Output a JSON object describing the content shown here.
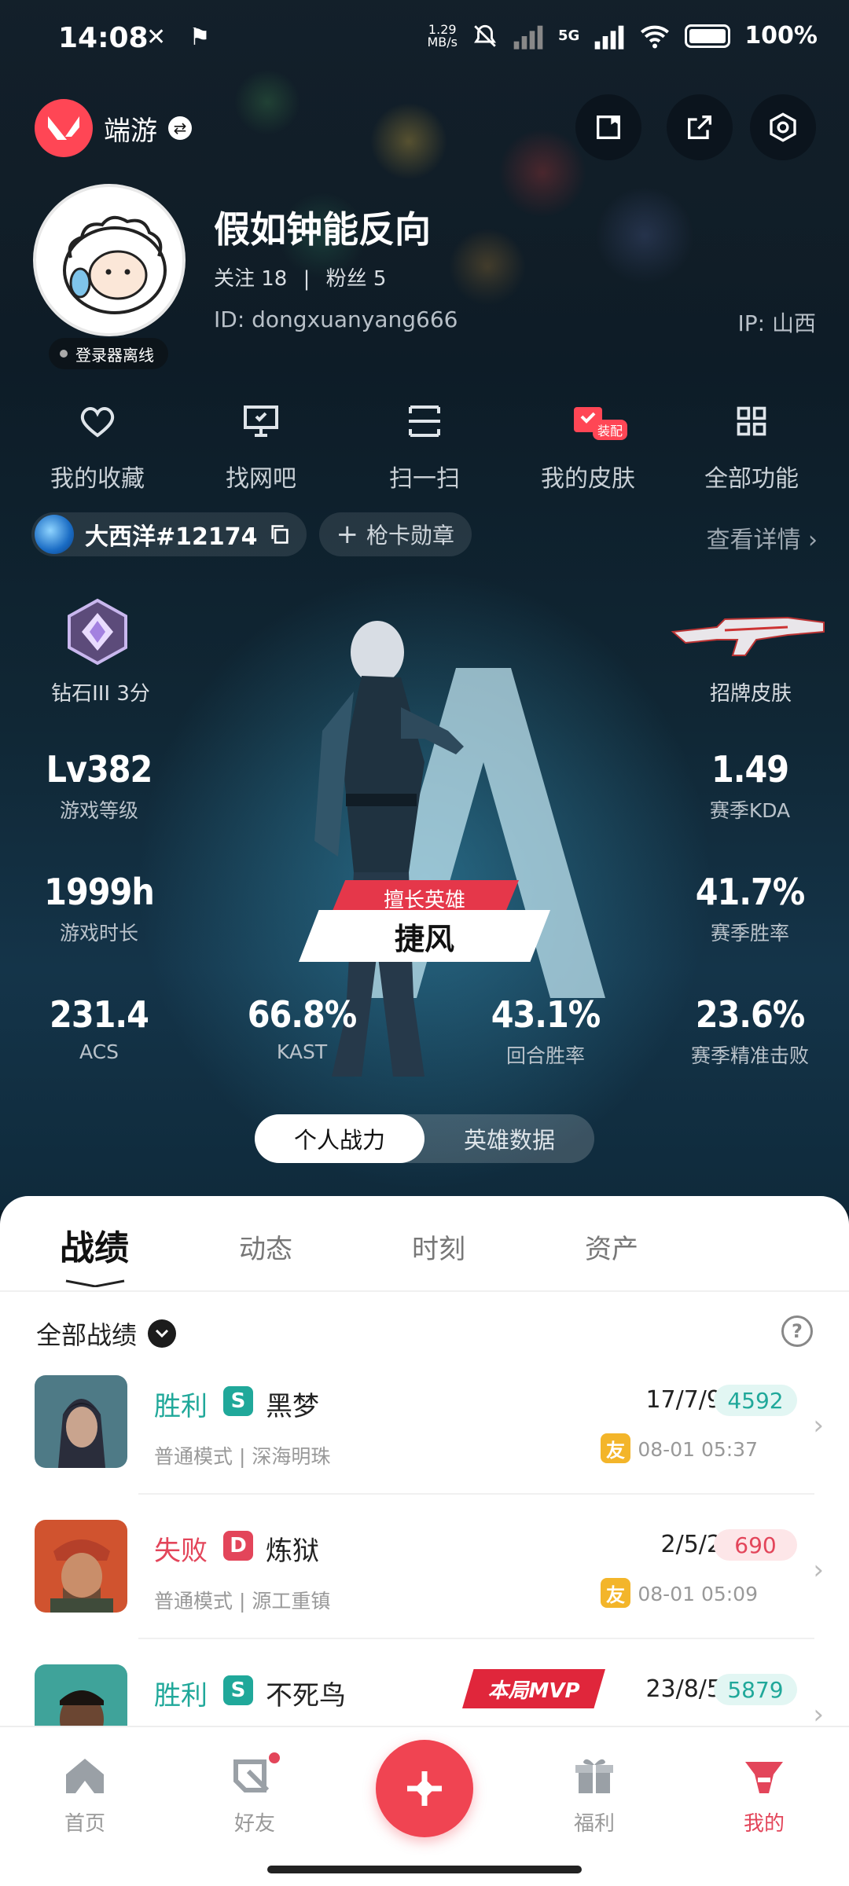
{
  "status_bar": {
    "time": "14:08",
    "left_icons": "✕ ⚑",
    "net_speed_value": "1.29",
    "net_speed_unit": "MB/s",
    "signal": "5G",
    "battery": "100%"
  },
  "header": {
    "app_name": "端游"
  },
  "profile": {
    "nickname": "假如钟能反向",
    "following_label": "关注 18",
    "followers_label": "粉丝 5",
    "separator": "|",
    "id": "ID: dongxuanyang666",
    "ip": "IP: 山西",
    "launcher_status": "登录器离线"
  },
  "quick_actions": [
    {
      "label": "我的收藏",
      "icon": "heart-icon"
    },
    {
      "label": "找网吧",
      "icon": "monitor-icon"
    },
    {
      "label": "扫一扫",
      "icon": "scan-icon"
    },
    {
      "label": "我的皮肤",
      "icon": "skin-icon",
      "badge": "装配"
    },
    {
      "label": "全部功能",
      "icon": "grid-icon"
    }
  ],
  "riot": {
    "id": "大西洋#12174",
    "badge_button": "枪卡勋章",
    "details_link": "查看详情 ›"
  },
  "stats": {
    "rank": "钻石III 3分",
    "signature_skin": "招牌皮肤",
    "level": {
      "value": "Lv382",
      "label": "游戏等级"
    },
    "kda": {
      "value": "1.49",
      "label": "赛季KDA"
    },
    "hours": {
      "value": "1999h",
      "label": "游戏时长"
    },
    "winrate": {
      "value": "41.7%",
      "label": "赛季胜率"
    },
    "acs": {
      "value": "231.4",
      "label": "ACS"
    },
    "kast": {
      "value": "66.8%",
      "label": "KAST"
    },
    "round_win": {
      "value": "43.1%",
      "label": "回合胜率"
    },
    "headshot": {
      "value": "23.6%",
      "label": "赛季精准击败"
    },
    "best_agent_tag": "擅长英雄",
    "best_agent": "捷风"
  },
  "toggle": {
    "active": "个人战力",
    "other": "英雄数据"
  },
  "tabs": [
    "战绩",
    "动态",
    "时刻",
    "资产"
  ],
  "filter": {
    "label": "全部战绩",
    "help": "?"
  },
  "matches": [
    {
      "result": "胜利",
      "grade": "S",
      "agent": "黑梦",
      "mode": "普通模式 | 深海明珠",
      "kda": "17/7/9",
      "score": "4592",
      "friend": "友",
      "time": "08-01 05:37"
    },
    {
      "result": "失败",
      "grade": "D",
      "agent": "炼狱",
      "mode": "普通模式 | 源工重镇",
      "kda": "2/5/2",
      "score": "690",
      "friend": "友",
      "time": "08-01 05:09"
    },
    {
      "result": "胜利",
      "grade": "S",
      "agent": "不死鸟",
      "mvp": "本局MVP",
      "kda": "23/8/5",
      "score": "5879"
    }
  ],
  "bottom_nav": [
    {
      "label": "首页"
    },
    {
      "label": "好友"
    },
    {
      "label": "福利"
    },
    {
      "label": "我的"
    }
  ],
  "colors": {
    "accent": "#ff4655",
    "win": "#20a89a",
    "lose": "#e3455a",
    "friend": "#f3b52a"
  }
}
